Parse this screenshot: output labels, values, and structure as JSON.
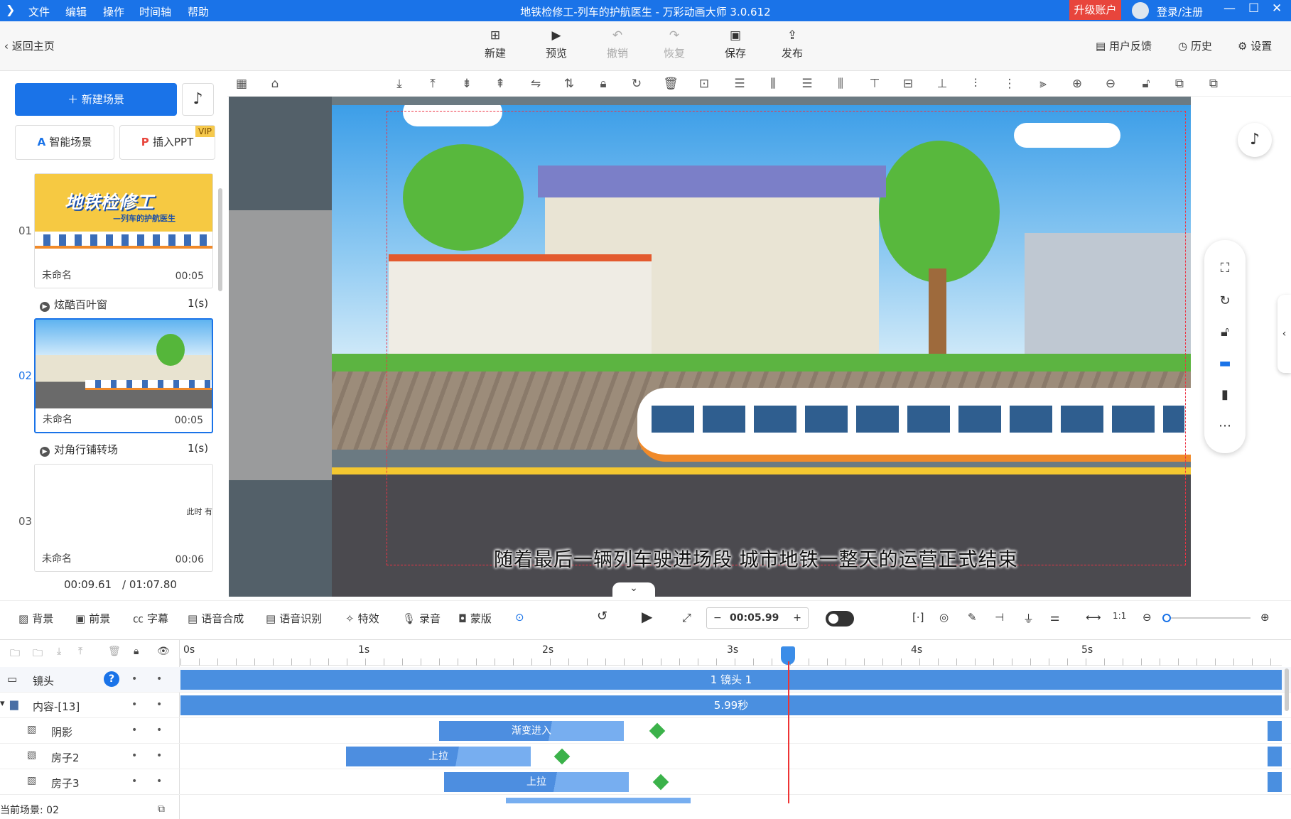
{
  "app": {
    "title": "地铁检修工-列车的护航医生 - 万彩动画大师 3.0.612",
    "menu": [
      "文件",
      "编辑",
      "操作",
      "时间轴",
      "帮助"
    ],
    "upgrade": "升级账户",
    "login": "登录/注册"
  },
  "toolbar": {
    "back": "返回主页",
    "new": "新建",
    "preview": "预览",
    "undo": "撤销",
    "redo": "恢复",
    "save": "保存",
    "publish": "发布",
    "feedback": "用户反馈",
    "history": "历史",
    "settings": "设置"
  },
  "left": {
    "new_scene": "新建场景",
    "ai_scene": "智能场景",
    "insert_ppt": "插入PPT",
    "vip": "VIP",
    "scenes": [
      {
        "num": "01",
        "name": "未命名",
        "time": "00:05",
        "thumb_title": "地铁检修工",
        "thumb_sub": "—列车的护航医生"
      },
      {
        "num": "02",
        "name": "未命名",
        "time": "00:05"
      },
      {
        "num": "03",
        "name": "未命名",
        "time": "00:06",
        "thumb_text": "此时 有"
      }
    ],
    "transitions": [
      {
        "name": "炫酷百叶窗",
        "time": "1(s)"
      },
      {
        "name": "对角行铺转场",
        "time": "1(s)"
      }
    ],
    "current_time": "00:09.61",
    "total_time": "/ 01:07.80"
  },
  "canvas": {
    "subtitle": "随着最后一辆列车驶进场段  城市地铁一整天的运营正式结束"
  },
  "controls": {
    "background": "背景",
    "foreground": "前景",
    "caption": "字幕",
    "tts": "语音合成",
    "asr": "语音识别",
    "effects": "特效",
    "record": "录音",
    "mask": "蒙版",
    "time": "00:05.99"
  },
  "timeline": {
    "ticks": [
      "0s",
      "1s",
      "2s",
      "3s",
      "4s",
      "5s"
    ],
    "camera_label": "镜头",
    "camera_bar": "1 镜头 1",
    "content_label": "内容-[13]",
    "content_bar": "5.99秒",
    "tracks": [
      {
        "name": "阴影",
        "clip": "渐变进入"
      },
      {
        "name": "房子2",
        "clip": "上拉"
      },
      {
        "name": "房子3",
        "clip": "上拉"
      }
    ],
    "status": "当前场景: 02"
  }
}
